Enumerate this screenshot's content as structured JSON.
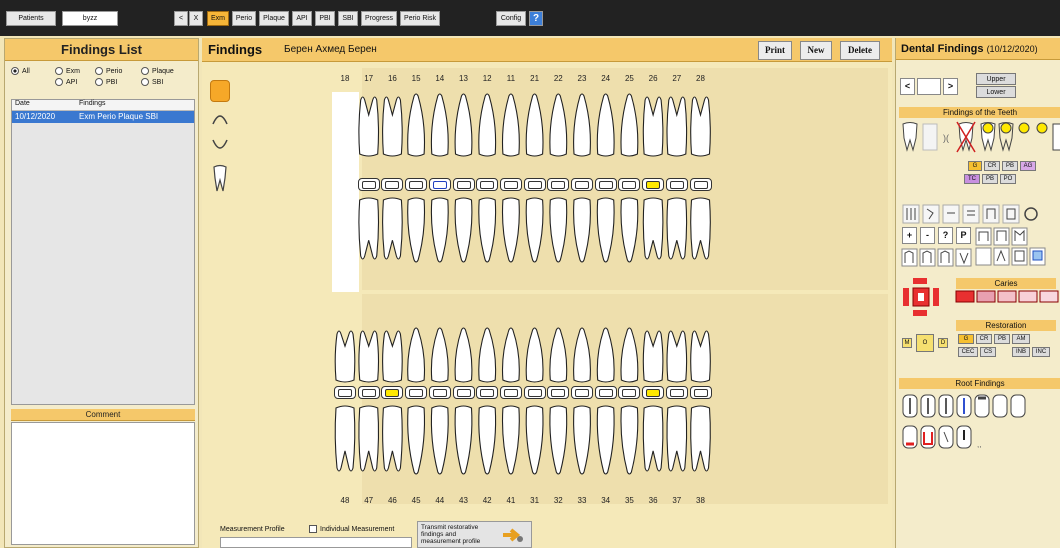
{
  "toolbar": {
    "patients_label": "Patients",
    "patient_field": "byzz",
    "nav_prev": "<",
    "nav_close": "X",
    "tabs": [
      "Exm",
      "Perio",
      "Plaque",
      "API",
      "PBI",
      "SBI",
      "Progress",
      "Perio Risk"
    ],
    "active_tab": "Exm",
    "config_label": "Config",
    "help_label": "?"
  },
  "left": {
    "title": "Findings List",
    "filters": [
      "All",
      "Exm",
      "Perio",
      "Plaque",
      "API",
      "PBI",
      "SBI"
    ],
    "selected_filter": "All",
    "columns": [
      "Date",
      "Findings"
    ],
    "rows": [
      {
        "date": "10/12/2020",
        "findings": "Exm Perio Plaque SBI"
      }
    ],
    "comment_title": "Comment"
  },
  "center": {
    "title": "Findings",
    "patient_name": "Берен Ахмед Берен",
    "print_label": "Print",
    "new_label": "New",
    "delete_label": "Delete",
    "upper_numbers": [
      "18",
      "17",
      "16",
      "15",
      "14",
      "13",
      "12",
      "11",
      "21",
      "22",
      "23",
      "24",
      "25",
      "26",
      "27",
      "28"
    ],
    "lower_numbers": [
      "48",
      "47",
      "46",
      "45",
      "44",
      "43",
      "42",
      "41",
      "31",
      "32",
      "33",
      "34",
      "35",
      "36",
      "37",
      "38"
    ],
    "upper_highlight": [
      "14:blue",
      "26:yellow"
    ],
    "lower_highlight": [
      "46:yellow",
      "36:yellow"
    ],
    "measurement_profile_label": "Measurement Profile",
    "individual_measurement_label": "Individual Measurement",
    "transmit_label": "Transmit restorative findings and measurement profile"
  },
  "right": {
    "title": "Dental Findings",
    "date": "(10/12/2020)",
    "upper_label": "Upper",
    "lower_label": "Lower",
    "nav_prev": "<",
    "nav_next": ">",
    "sections": [
      "Findings of the Teeth",
      "Caries",
      "Restoration",
      "Root Findings"
    ],
    "symbols": [
      "+",
      "-",
      "?",
      "P"
    ],
    "surface_labels": [
      "M",
      "O",
      "D"
    ],
    "tags_teeth": [
      "G",
      "CR",
      "PB",
      "AG",
      "TC",
      "PB",
      "PO"
    ],
    "tags_restoration": [
      "G",
      "CR",
      "PB",
      "AM",
      "CEC",
      "CS",
      "INB",
      "INC"
    ]
  }
}
